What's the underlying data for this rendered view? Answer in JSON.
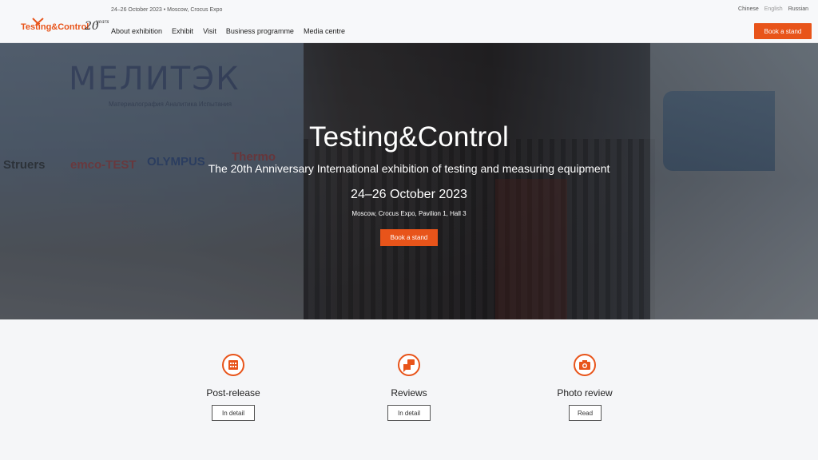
{
  "header": {
    "logo_brand": "Testing&Control",
    "logo_years": "20",
    "logo_years_word": "years",
    "top_info": "24–26 October 2023 • Moscow, Crocus Expo",
    "languages": [
      "Chinese",
      "English",
      "Russian"
    ],
    "active_language": "English",
    "nav": [
      "About exhibition",
      "Exhibit",
      "Visit",
      "Business programme",
      "Media centre"
    ],
    "book_label": "Book a stand"
  },
  "hero": {
    "wall_name": "МЕЛИТЭК",
    "wall_sub": "Материалография Аналитика Испытания",
    "brands": [
      "Struers",
      "emco-TEST",
      "OLYMPUS",
      "Thermo"
    ],
    "title": "Testing&Control",
    "subtitle": "The 20th Anniversary International exhibition of testing and measuring equipment",
    "dates": "24–26 October 2023",
    "place": "Moscow, Crocus Expo, Pavilion 1, Hall 3",
    "book_label": "Book a stand"
  },
  "cards": [
    {
      "title": "Post-release",
      "button": "In detail",
      "icon": "calendar-icon"
    },
    {
      "title": "Reviews",
      "button": "In detail",
      "icon": "chat-icon"
    },
    {
      "title": "Photo review",
      "button": "Read",
      "icon": "camera-icon"
    }
  ],
  "colors": {
    "accent": "#e8541a",
    "background": "#f5f6f8"
  }
}
